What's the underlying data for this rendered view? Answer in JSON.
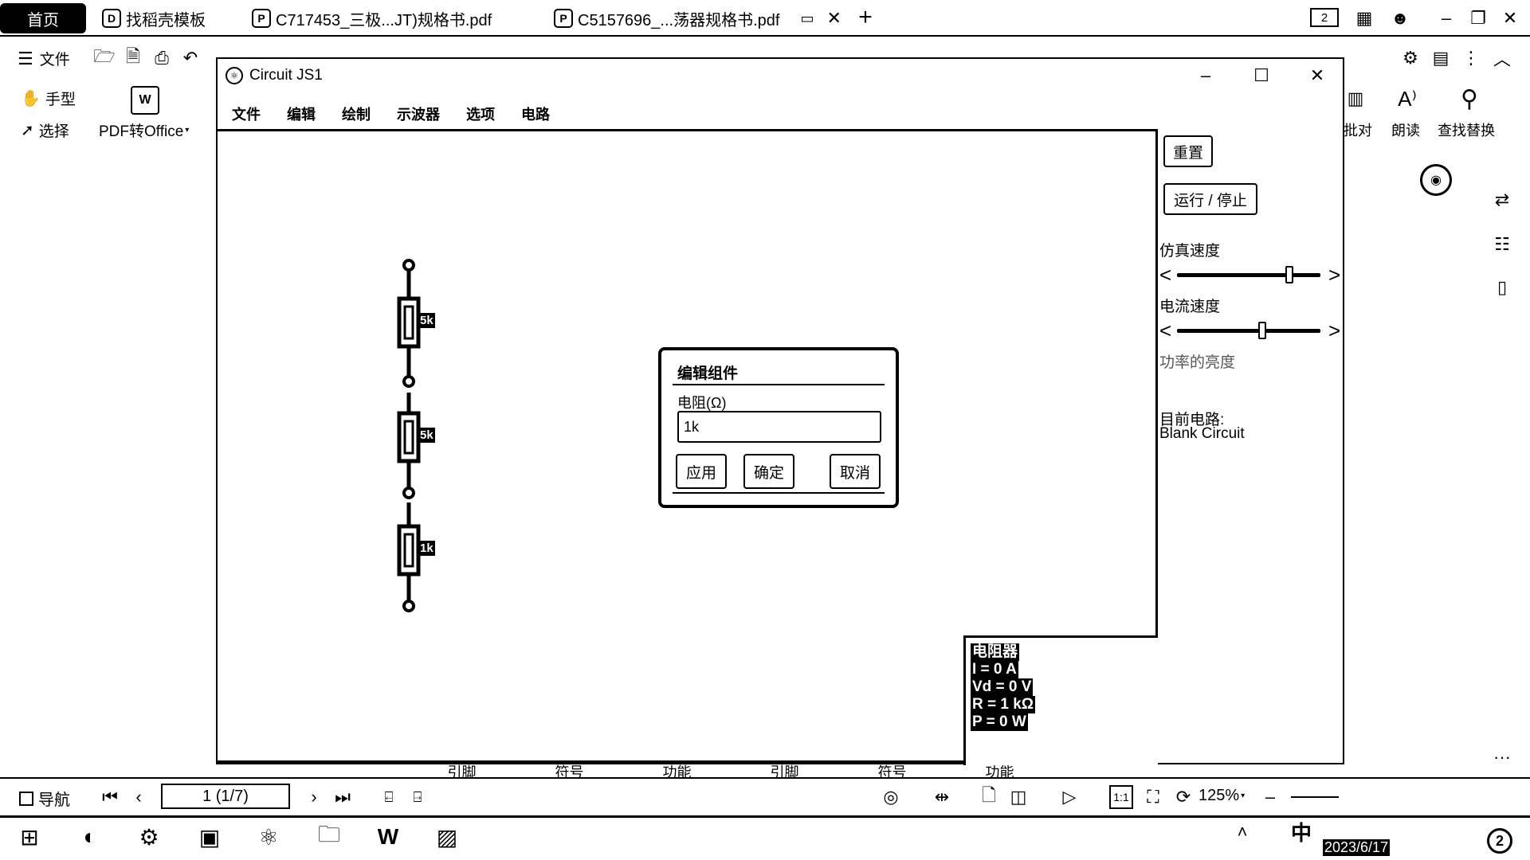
{
  "browser_tabs": [
    {
      "label": "首页"
    },
    {
      "label": "找稻壳模板"
    },
    {
      "label": "C717453_三极...JT)规格书.pdf"
    },
    {
      "label": "C5157696_...荡器规格书.pdf"
    }
  ],
  "title_bar": {
    "page_count_box": "2",
    "new_tab": "+",
    "close": "✕"
  },
  "wps_toolbar": {
    "file_menu": "文件",
    "hand_tool": "手型",
    "select_tool": "选择",
    "pdf_to_office": "PDF转Office",
    "right_tools": [
      "批对",
      "朗读",
      "查找替换"
    ]
  },
  "circuit_window": {
    "title": "Circuit JS1",
    "menu": [
      "文件",
      "编辑",
      "绘制",
      "示波器",
      "选项",
      "电路"
    ],
    "resistors": [
      {
        "label": "5k"
      },
      {
        "label": "5k"
      },
      {
        "label": "1k"
      }
    ],
    "info_box": {
      "title": "电阻器",
      "lines": [
        "I = 0 A",
        "Vd = 0 V",
        "R = 1 kΩ",
        "P = 0 W"
      ]
    },
    "side_panel": {
      "reset_button": "重置",
      "run_stop_button": "运行 / 停止",
      "sim_speed_label": "仿真速度",
      "sim_speed_level": 0.8,
      "current_speed_label": "电流速度",
      "current_speed_level": 0.6,
      "power_brightness_label": "功率的亮度",
      "current_circuit_label": "目前电路:",
      "current_circuit_name": "Blank Circuit"
    }
  },
  "edit_dialog": {
    "title": "编辑组件",
    "field_label": "电阻(Ω)",
    "field_value": "1k",
    "apply_button": "应用",
    "ok_button": "确定",
    "cancel_button": "取消"
  },
  "status_bar": {
    "nav_label": "导航",
    "page_display": "1 (1/7)",
    "zoom": "125%"
  },
  "taskbar": {
    "ime": "中",
    "date": "2023/6/17",
    "badge": "2"
  },
  "background_table_fragments": [
    "引脚",
    "符号",
    "功能",
    "引脚",
    "符号",
    "功能"
  ]
}
